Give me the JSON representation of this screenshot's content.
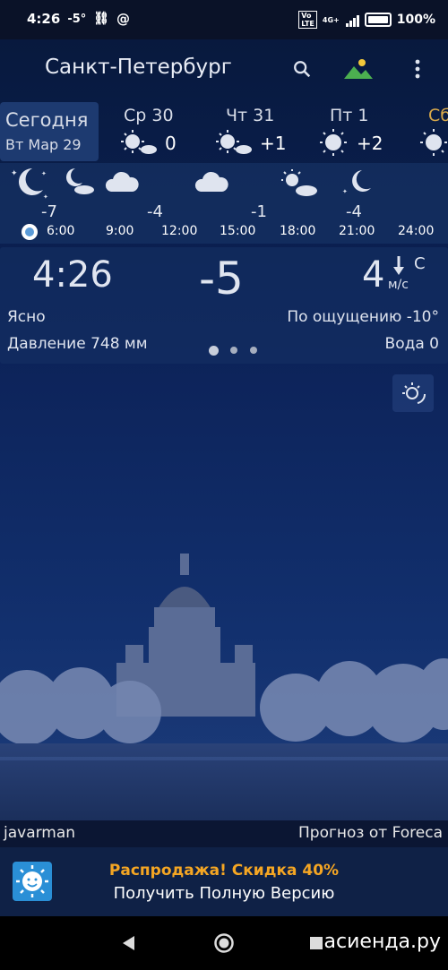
{
  "status": {
    "time": "4:26",
    "temp": "-5°",
    "battery": "100%",
    "net": "4G+"
  },
  "app": {
    "city": "Санкт-Петербург"
  },
  "days": [
    {
      "name": "Сегодня",
      "sub": "Вт Мар 29"
    },
    {
      "name": "Ср 30",
      "temp": "0"
    },
    {
      "name": "Чт 31",
      "temp": "+1"
    },
    {
      "name": "Пт 1",
      "temp": "+2"
    },
    {
      "name": "Сб",
      "temp": ""
    }
  ],
  "hourly": {
    "temps": [
      "-7",
      "-4",
      "-1",
      "-4"
    ],
    "hours": [
      "6:00",
      "9:00",
      "12:00",
      "15:00",
      "18:00",
      "21:00",
      "24:00"
    ]
  },
  "now": {
    "time": "4:26",
    "temp": "-5",
    "wind_speed": "4",
    "wind_dir": "С",
    "wind_unit": "м/с",
    "condition": "Ясно",
    "feels": "По ощущению -10°",
    "pressure": "Давление 748 мм",
    "water": "Вода 0"
  },
  "footer": {
    "author": "javarman",
    "source": "Прогноз от Foreca"
  },
  "promo": {
    "title": "Распродажа! Скидка 40%",
    "subtitle": "Получить Полную Версию"
  },
  "watermark": "асиенда.ру",
  "colors": {
    "promo_title": "#f5a623",
    "day_weekend": "#d9a94a"
  }
}
